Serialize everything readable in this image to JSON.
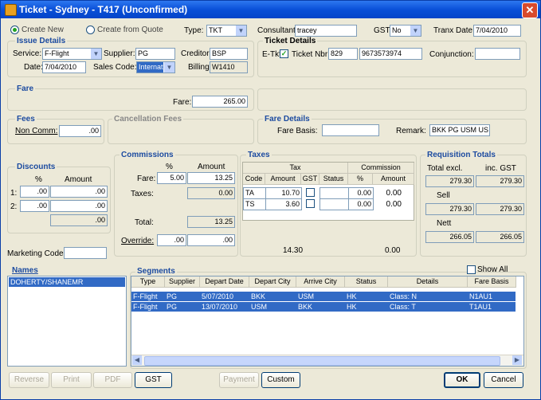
{
  "window": {
    "title": "Ticket - Sydney - T417 (Unconfirmed)"
  },
  "top": {
    "create_new": "Create New",
    "create_from_quote": "Create from Quote",
    "type_label": "Type:",
    "type_value": "TKT",
    "consultant_label": "Consultant:",
    "consultant_value": "tracey",
    "gst_label": "GST:",
    "gst_value": "No",
    "tranx_date_label": "Tranx Date:",
    "tranx_date_value": "7/04/2010"
  },
  "issue": {
    "title": "Issue Details",
    "service_label": "Service:",
    "service_value": "F-Flight",
    "supplier_label": "Supplier:",
    "supplier_value": "PG",
    "creditor_label": "Creditor:",
    "creditor_value": "BSP",
    "date_label": "Date:",
    "date_value": "7/04/2010",
    "sales_code_label": "Sales Code:",
    "sales_code_value": "Internat",
    "billing_label": "Billing:",
    "billing_value": "W1410"
  },
  "ticket": {
    "title": "Ticket Details",
    "etkt_label": "E-Tkt",
    "etkt_checked": "✓",
    "nbr_label": "Ticket Nbr:",
    "nbr_prefix": "829",
    "nbr_value": "9673573974",
    "conj_label": "Conjunction:",
    "conj_value": ""
  },
  "fare": {
    "title": "Fare",
    "label": "Fare:",
    "value": "265.00"
  },
  "fees": {
    "title": "Fees",
    "non_comm_label": "Non Comm:",
    "non_comm_value": ".00"
  },
  "cancellation": {
    "title": "Cancellation Fees"
  },
  "fare_details": {
    "title": "Fare Details",
    "basis_label": "Fare Basis:",
    "basis_value": "",
    "remark_label": "Remark:",
    "remark_value": "BKK PG USM US"
  },
  "discounts": {
    "title": "Discounts",
    "pct_header": "%",
    "amount_header": "Amount",
    "row1_label": "1:",
    "row1_pct": ".00",
    "row1_amt": ".00",
    "row2_label": "2:",
    "row2_pct": ".00",
    "row2_amt": ".00",
    "total": ".00"
  },
  "commissions": {
    "title": "Commissions",
    "pct_header": "%",
    "amount_header": "Amount",
    "fare_label": "Fare:",
    "fare_pct": "5.00",
    "fare_amt": "13.25",
    "taxes_label": "Taxes:",
    "taxes_amt": "0.00",
    "total_label": "Total:",
    "total_amt": "13.25",
    "override_label": "Override:",
    "override_pct": ".00",
    "override_amt": ".00"
  },
  "taxes": {
    "title": "Taxes",
    "tax_header": "Tax",
    "commission_header": "Commission",
    "cols": [
      "Code",
      "Amount",
      "GST",
      "Status",
      "%",
      "Amount"
    ],
    "rows": [
      {
        "code": "TA",
        "amount": "10.70",
        "pct": "0.00",
        "comm": "0.00"
      },
      {
        "code": "TS",
        "amount": "3.60",
        "pct": "0.00",
        "comm": "0.00"
      }
    ],
    "total_amount": "14.30",
    "total_comm": "0.00"
  },
  "requisition": {
    "title": "Requisition Totals",
    "excl_label": "Total excl.",
    "incl_label": "inc. GST",
    "total_excl": "279.30",
    "total_incl": "279.30",
    "sell_label": "Sell",
    "sell_excl": "279.30",
    "sell_incl": "279.30",
    "nett_label": "Nett",
    "nett_excl": "266.05",
    "nett_incl": "266.05"
  },
  "marketing": {
    "label": "Marketing Code:",
    "value": ""
  },
  "names": {
    "title": "Names",
    "items": [
      "DOHERTY/SHANEMR"
    ]
  },
  "segments": {
    "title": "Segments",
    "show_all": "Show All",
    "cols": [
      "Type",
      "Supplier",
      "Depart Date",
      "Depart City",
      "Arrive City",
      "Status",
      "Details",
      "Fare Basis"
    ],
    "rows": [
      [
        "F-Flight",
        "PG",
        "5/07/2010",
        "BKK",
        "USM",
        "HK",
        "Class: N",
        "N1AU1"
      ],
      [
        "F-Flight",
        "PG",
        "13/07/2010",
        "USM",
        "BKK",
        "HK",
        "Class: T",
        "T1AU1"
      ]
    ]
  },
  "buttons": {
    "reverse": "Reverse",
    "print": "Print",
    "pdf": "PDF",
    "gst": "GST",
    "payment": "Payment",
    "custom": "Custom",
    "ok": "OK",
    "cancel": "Cancel"
  },
  "colors": {
    "title_bar": "#0a50d8",
    "selection": "#316ac5",
    "group_header": "#1c4ba0"
  }
}
